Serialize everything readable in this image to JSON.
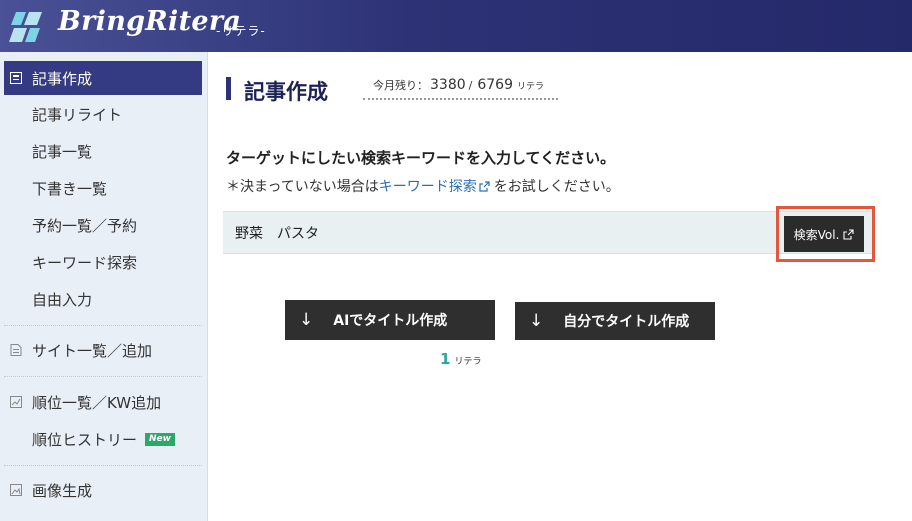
{
  "header": {
    "brand": "BringRitera",
    "brand_sub": "-リテラ-"
  },
  "sidebar": {
    "items": [
      {
        "label": "記事作成",
        "active": true
      },
      {
        "label": "記事リライト"
      },
      {
        "label": "記事一覧"
      },
      {
        "label": "下書き一覧"
      },
      {
        "label": "予約一覧／予約"
      },
      {
        "label": "キーワード探索"
      },
      {
        "label": "自由入力"
      },
      {
        "label": "サイト一覧／追加"
      },
      {
        "label": "順位一覧／KW追加"
      },
      {
        "label": "順位ヒストリー",
        "badge": "New"
      },
      {
        "label": "画像生成"
      }
    ]
  },
  "main": {
    "title": "記事作成",
    "remaining": {
      "label": "今月残り：",
      "used": "3380",
      "sep": "/",
      "total": "6769",
      "unit": "リテラ"
    },
    "instruction": "ターゲットにしたい検索キーワードを入力してください。",
    "note_prefix": "＊決まっていない場合は",
    "note_link": "キーワード探索",
    "note_suffix": "をお試しください。",
    "keyword_value": "野菜　パスタ",
    "vol_button": "検索Vol.",
    "ai_button": "AIでタイトル作成",
    "self_button": "自分でタイトル作成",
    "cost_num": "1",
    "cost_unit": "リテラ",
    "arrow": "↓"
  },
  "colors": {
    "header": "#2c3275",
    "active_nav": "#353b83",
    "link": "#2a6fb5",
    "highlight": "#e4573d",
    "new_badge": "#2ea86a",
    "cost": "#2ba7a0"
  }
}
